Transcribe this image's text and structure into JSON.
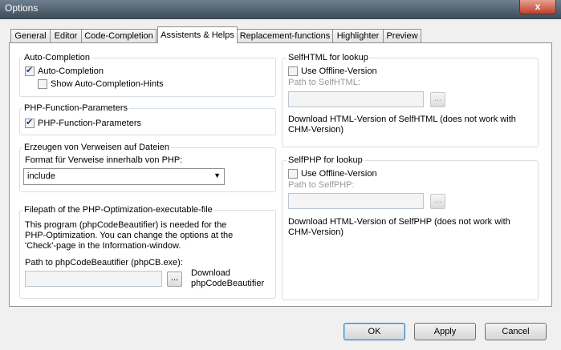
{
  "window": {
    "title": "Options",
    "close_label": "x"
  },
  "tabs": [
    {
      "label": "General"
    },
    {
      "label": "Editor"
    },
    {
      "label": "Code-Completion"
    },
    {
      "label": "Assistents & Helps"
    },
    {
      "label": "Replacement-functions"
    },
    {
      "label": "Highlighter"
    },
    {
      "label": "Preview"
    }
  ],
  "auto_completion": {
    "title": "Auto-Completion",
    "auto_completion_label": "Auto-Completion",
    "auto_completion_checked": true,
    "hints_label": "Show Auto-Completion-Hints",
    "hints_checked": false
  },
  "php_params": {
    "title": "PHP-Function-Parameters",
    "label": "PHP-Function-Parameters",
    "checked": true
  },
  "references": {
    "title": "Erzeugen von Verweisen auf Dateien",
    "format_label": "Format für Verweise innerhalb von PHP:",
    "format_value": "include"
  },
  "optimizer": {
    "title": "Filepath of the PHP-Optimization-executable-file",
    "desc_line1": "This program (phpCodeBeautifier) is needed for the",
    "desc_line2": "PHP-Optimization. You can change the options at the",
    "desc_line3": "'Check'-page in the Information-window.",
    "path_label": "Path to phpCodeBeautifier (phpCB.exe):",
    "path_value": "",
    "browse_label": "...",
    "download_line1": "Download",
    "download_line2": "phpCodeBeautifier"
  },
  "selfhtml": {
    "title": "SelfHTML for lookup",
    "offline_label": "Use Offline-Version",
    "offline_checked": false,
    "path_label": "Path to SelfHTML:",
    "path_value": "",
    "browse_label": "...",
    "download_line1": "Download HTML-Version of SelfHTML (does not work with",
    "download_line2": "CHM-Version)"
  },
  "selfphp": {
    "title": "SelfPHP for lookup",
    "offline_label": "Use Offline-Version",
    "offline_checked": false,
    "path_label": "Path to SelfPHP:",
    "path_value": "",
    "browse_label": "...",
    "download_line1": "Download HTML-Version of SelfPHP (does not work with",
    "download_line2": "CHM-Version)"
  },
  "buttons": {
    "ok": "OK",
    "apply": "Apply",
    "cancel": "Cancel"
  }
}
